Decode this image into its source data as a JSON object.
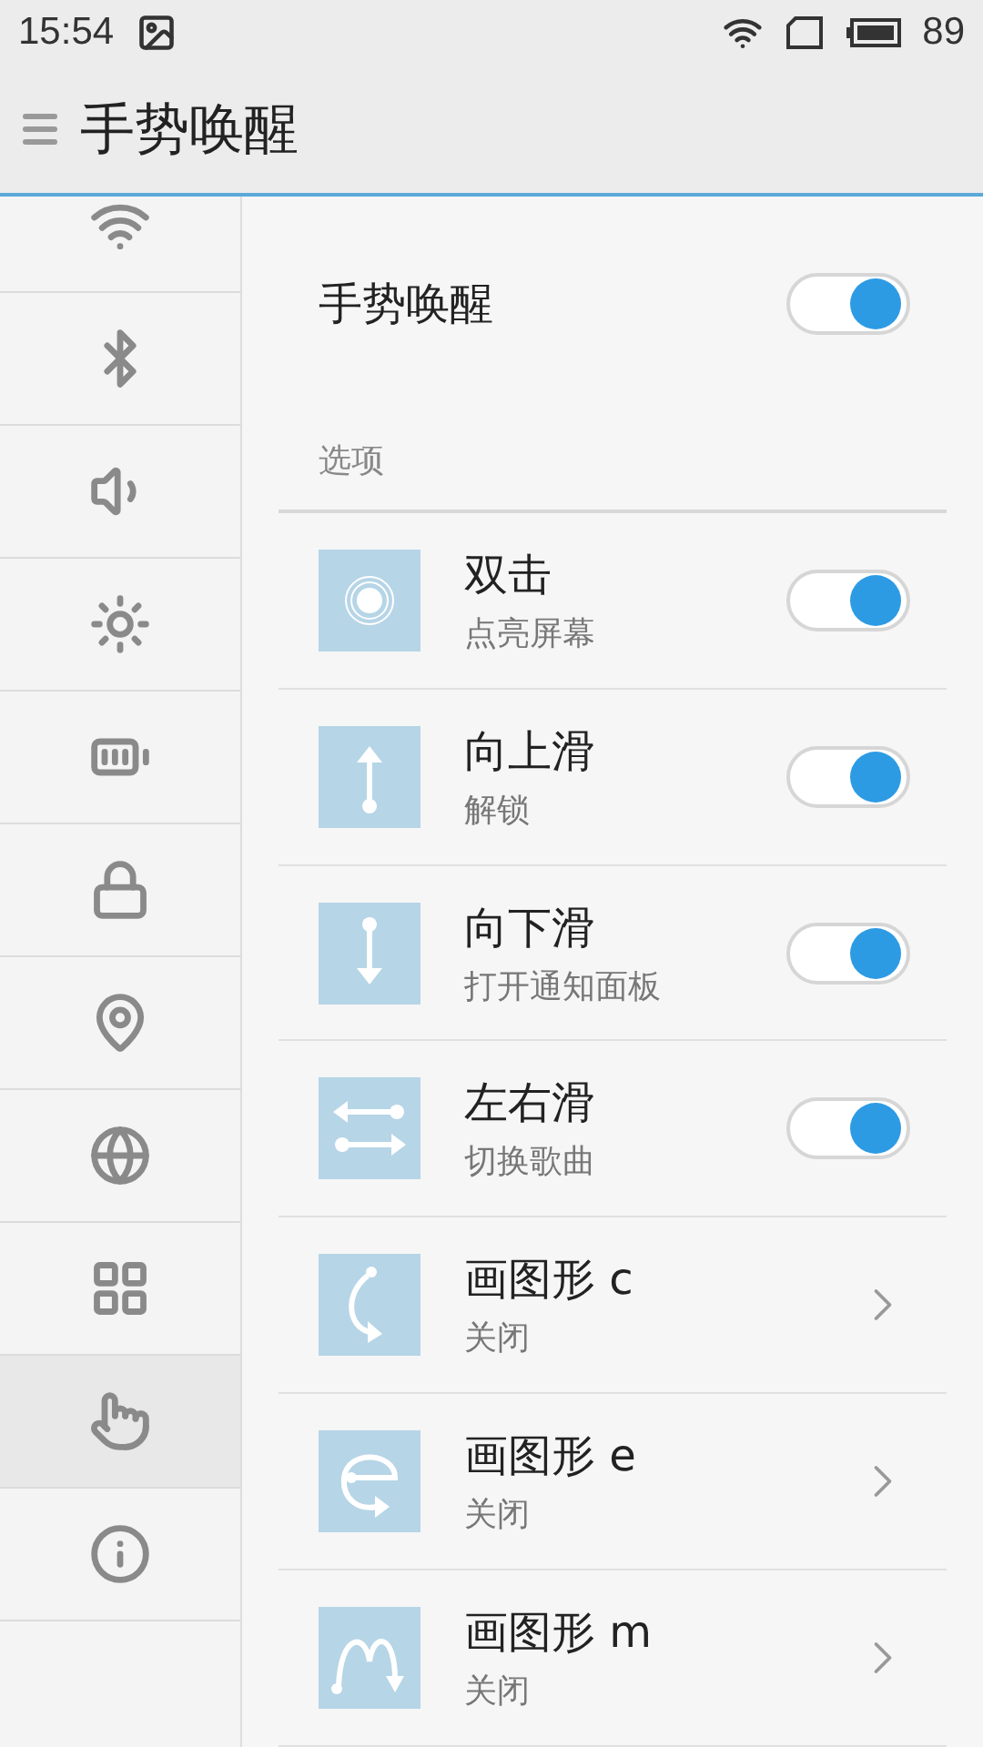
{
  "status_bar": {
    "time": "15:54",
    "battery": "89"
  },
  "header": {
    "title": "手势唤醒"
  },
  "sidebar": {
    "items": [
      {
        "selected": false
      },
      {
        "selected": false
      },
      {
        "selected": false
      },
      {
        "selected": false
      },
      {
        "selected": false
      },
      {
        "selected": false
      },
      {
        "selected": false
      },
      {
        "selected": false
      },
      {
        "selected": false
      },
      {
        "selected": true
      },
      {
        "selected": false
      }
    ]
  },
  "master": {
    "label": "手势唤醒",
    "on": true
  },
  "section": {
    "title": "选项"
  },
  "options": [
    {
      "kind": "toggle",
      "title": "双击",
      "subtitle": "点亮屏幕",
      "on": true
    },
    {
      "kind": "toggle",
      "title": "向上滑",
      "subtitle": "解锁",
      "on": true
    },
    {
      "kind": "toggle",
      "title": "向下滑",
      "subtitle": "打开通知面板",
      "on": true
    },
    {
      "kind": "toggle",
      "title": "左右滑",
      "subtitle": "切换歌曲",
      "on": true
    },
    {
      "kind": "link",
      "title": "画图形 c",
      "subtitle": "关闭"
    },
    {
      "kind": "link",
      "title": "画图形 e",
      "subtitle": "关闭"
    },
    {
      "kind": "link",
      "title": "画图形 m",
      "subtitle": "关闭"
    }
  ]
}
